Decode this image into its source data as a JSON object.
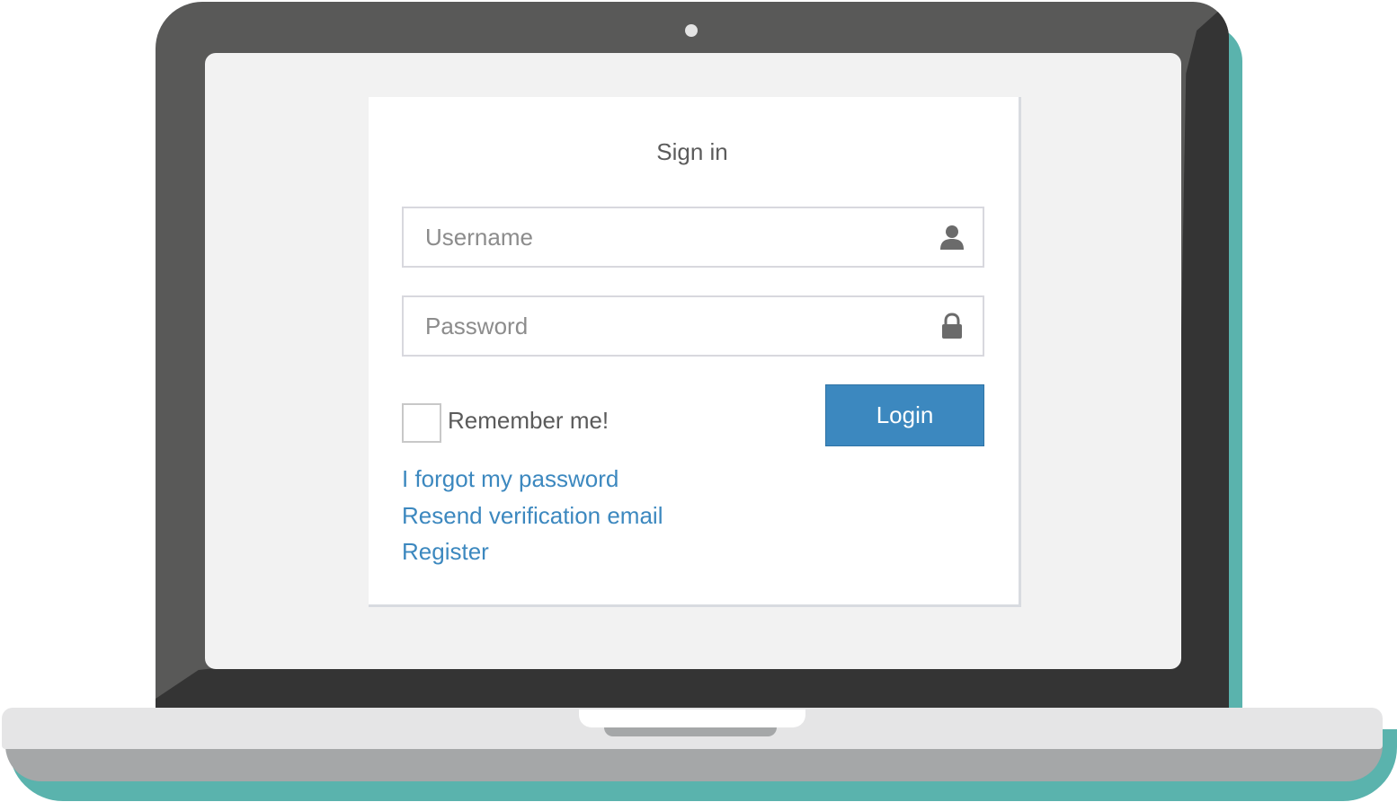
{
  "login_form": {
    "title": "Sign in",
    "username": {
      "placeholder": "Username",
      "value": "",
      "icon": "user-icon"
    },
    "password": {
      "placeholder": "Password",
      "value": "",
      "icon": "lock-icon"
    },
    "remember_label": "Remember me!",
    "remember_checked": false,
    "login_label": "Login",
    "links": {
      "forgot": "I forgot my password",
      "resend": "Resend verification email",
      "register": "Register"
    }
  },
  "colors": {
    "accent": "#3c88bf",
    "lid": "#595958",
    "lid_dark": "#343434",
    "shadow": "#5ab3ad",
    "screen": "#f2f2f2"
  }
}
